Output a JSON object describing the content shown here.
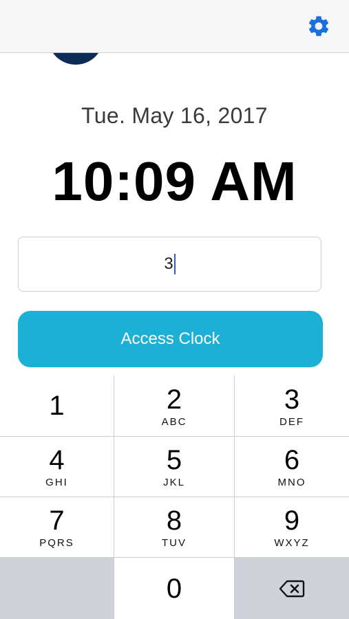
{
  "header": {
    "settings_icon": "gear-icon",
    "accent_color": "#1a6fe0"
  },
  "clock": {
    "date": "Tue. May 16, 2017",
    "time": "10:09 AM"
  },
  "pin_input": {
    "value": "3"
  },
  "access_button": {
    "label": "Access Clock",
    "color": "#1cb0d6"
  },
  "keypad": {
    "keys": [
      {
        "digit": "1",
        "letters": ""
      },
      {
        "digit": "2",
        "letters": "ABC"
      },
      {
        "digit": "3",
        "letters": "DEF"
      },
      {
        "digit": "4",
        "letters": "GHI"
      },
      {
        "digit": "5",
        "letters": "JKL"
      },
      {
        "digit": "6",
        "letters": "MNO"
      },
      {
        "digit": "7",
        "letters": "PQRS"
      },
      {
        "digit": "8",
        "letters": "TUV"
      },
      {
        "digit": "9",
        "letters": "WXYZ"
      },
      {
        "digit": "0",
        "letters": ""
      }
    ],
    "backspace_icon": "backspace-icon"
  }
}
